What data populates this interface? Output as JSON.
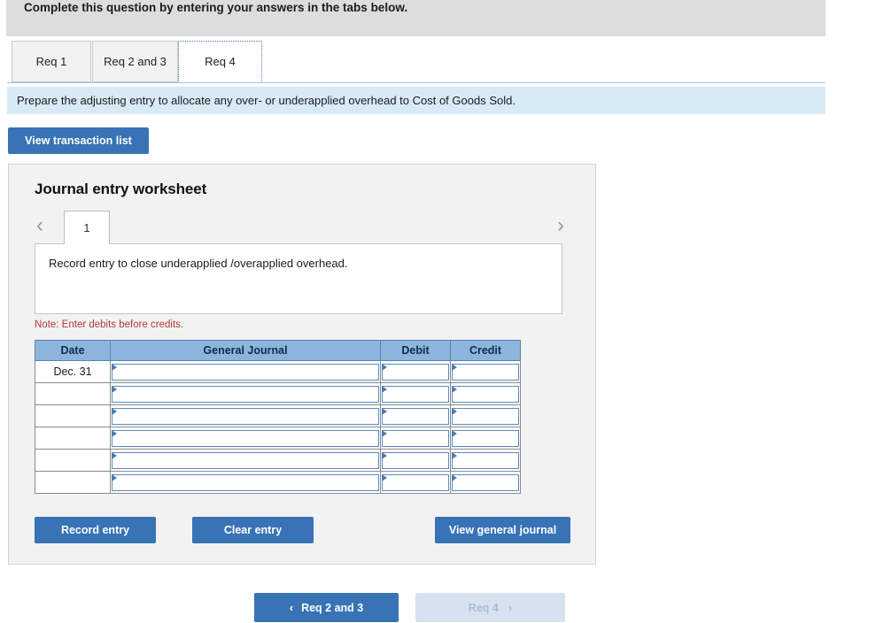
{
  "banner": {
    "text": "Complete this question by entering your answers in the tabs below."
  },
  "tabs": [
    {
      "label": "Req 1",
      "active": false
    },
    {
      "label": "Req 2 and 3",
      "active": false
    },
    {
      "label": "Req 4",
      "active": true
    }
  ],
  "instruction": {
    "text": "Prepare the adjusting entry to allocate any over- or underapplied overhead to Cost of Goods Sold."
  },
  "toolbar": {
    "view_transaction_list_label": "View transaction list"
  },
  "worksheet": {
    "title": "Journal entry worksheet",
    "pager": {
      "prev_icon": "chevron-left-icon",
      "next_icon": "chevron-right-icon",
      "current_page": "1"
    },
    "entry_description": "Record entry to close underapplied /overapplied overhead.",
    "note": "Note: Enter debits before credits.",
    "table": {
      "columns": [
        "Date",
        "General Journal",
        "Debit",
        "Credit"
      ],
      "rows": [
        {
          "date": "Dec. 31",
          "general_journal": "",
          "debit": "",
          "credit": ""
        },
        {
          "date": "",
          "general_journal": "",
          "debit": "",
          "credit": ""
        },
        {
          "date": "",
          "general_journal": "",
          "debit": "",
          "credit": ""
        },
        {
          "date": "",
          "general_journal": "",
          "debit": "",
          "credit": ""
        },
        {
          "date": "",
          "general_journal": "",
          "debit": "",
          "credit": ""
        },
        {
          "date": "",
          "general_journal": "",
          "debit": "",
          "credit": ""
        }
      ]
    },
    "actions": {
      "record_entry_label": "Record entry",
      "clear_entry_label": "Clear entry",
      "view_general_journal_label": "View general journal"
    }
  },
  "bottom_nav": {
    "prev_chevron": "‹",
    "prev_label": "Req 2 and 3",
    "next_label": "Req 4",
    "next_chevron": "›",
    "next_disabled": true
  },
  "colors": {
    "accent_blue": "#3773b5",
    "banner_gray": "#dddddd",
    "instruction_blue": "#d9eaf7",
    "table_header_blue": "#8cb5dd",
    "note_red": "#b03a3a",
    "disabled_blue": "#d6e2ef"
  }
}
